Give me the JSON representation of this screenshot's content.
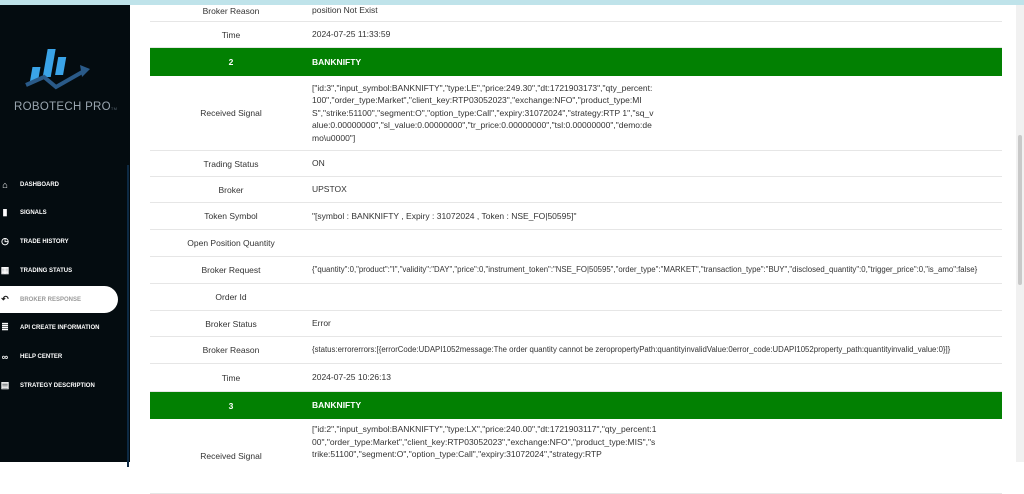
{
  "brand": {
    "name": "ROBOTECH PRO",
    "suffix": "TM"
  },
  "menu": [
    {
      "label": "DASHBOARD",
      "icon": "home-icon"
    },
    {
      "label": "SIGNALS",
      "icon": "signal-bars-icon"
    },
    {
      "label": "TRADE HISTORY",
      "icon": "history-icon"
    },
    {
      "label": "TRADING STATUS",
      "icon": "status-icon"
    },
    {
      "label": "BROKER RESPONSE",
      "icon": "reply-icon",
      "active": true
    },
    {
      "label": "API CREATE INFORMATION",
      "icon": "database-icon"
    },
    {
      "label": "HELP CENTER",
      "icon": "handshake-icon"
    },
    {
      "label": "STRATEGY DESCRIPTION",
      "icon": "document-icon"
    }
  ],
  "labels": {
    "broker_reason": "Broker Reason",
    "time": "Time",
    "received_signal": "Received Signal",
    "trading_status": "Trading Status",
    "broker": "Broker",
    "token_symbol": "Token Symbol",
    "open_position_quantity": "Open Position Quantity",
    "broker_request": "Broker Request",
    "order_id": "Order Id",
    "broker_status": "Broker Status"
  },
  "prev": {
    "broker_reason": "position Not Exist",
    "time": "2024-07-25 11:33:59"
  },
  "record2": {
    "index": "2",
    "symbol": "BANKNIFTY",
    "received_signal": "[\"id:3\",\"input_symbol:BANKNIFTY\",\"type:LE\",\"price:249.30\",\"dt:1721903173\",\"qty_percent:100\",\"order_type:Market\",\"client_key:RTP03052023\",\"exchange:NFO\",\"product_type:MIS\",\"strike:51100\",\"segment:O\",\"option_type:Call\",\"expiry:31072024\",\"strategy:RTP 1\",\"sq_value:0.00000000\",\"sl_value:0.00000000\",\"tr_price:0.00000000\",\"tsl:0.00000000\",\"demo:demo\\u0000\"]",
    "trading_status": "ON",
    "broker": "UPSTOX",
    "token_symbol": "\"[symbol : BANKNIFTY , Expiry : 31072024 , Token : NSE_FO|50595]\"",
    "open_position_quantity": "",
    "broker_request": "{\"quantity\":0,\"product\":\"I\",\"validity\":\"DAY\",\"price\":0,\"instrument_token\":\"NSE_FO|50595\",\"order_type\":\"MARKET\",\"transaction_type\":\"BUY\",\"disclosed_quantity\":0,\"trigger_price\":0,\"is_amo\":false}",
    "order_id": "",
    "broker_status": "Error",
    "broker_reason": "{status:errorerrors:[{errorCode:UDAPI1052message:The order quantity cannot be zeropropertyPath:quantityinvalidValue:0error_code:UDAPI1052property_path:quantityinvalid_value:0}]}",
    "time": "2024-07-25 10:26:13"
  },
  "record3": {
    "index": "3",
    "symbol": "BANKNIFTY",
    "received_signal": "[\"id:2\",\"input_symbol:BANKNIFTY\",\"type:LX\",\"price:240.00\",\"dt:1721903117\",\"qty_percent:100\",\"order_type:Market\",\"client_key:RTP03052023\",\"exchange:NFO\",\"product_type:MIS\",\"strike:51100\",\"segment:O\",\"option_type:Call\",\"expiry:31072024\",\"strategy:RTP"
  }
}
